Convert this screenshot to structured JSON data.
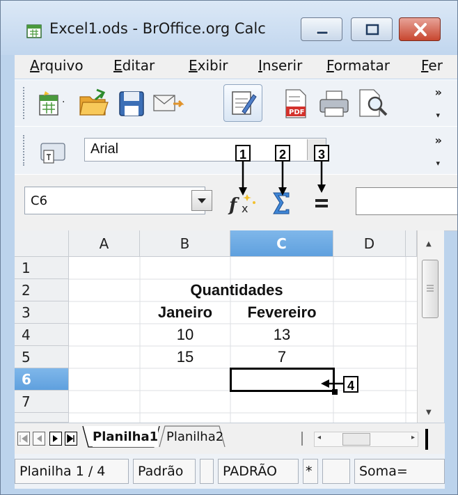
{
  "window": {
    "title": "Excel1.ods - BrOffice.org Calc"
  },
  "menu": [
    {
      "hot": "A",
      "rest": "rquivo"
    },
    {
      "hot": "E",
      "rest": "ditar"
    },
    {
      "hot": "E",
      "rest": "xibir"
    },
    {
      "hot": "I",
      "rest": "nserir"
    },
    {
      "hot": "F",
      "rest": "ormatar"
    },
    {
      "hot": "F",
      "rest": "er"
    }
  ],
  "formatting": {
    "font_name": "Arial"
  },
  "formula_bar": {
    "name_box": "C6",
    "formula_value": ""
  },
  "callouts": [
    "1",
    "2",
    "3",
    "4"
  ],
  "sheet": {
    "columns": [
      "A",
      "B",
      "C",
      "D"
    ],
    "rows": [
      "1",
      "2",
      "3",
      "4",
      "5",
      "6",
      "7"
    ],
    "selected_column": "C",
    "selected_row": "6",
    "cells": {
      "B2": "Quantidades",
      "B3": "Janeiro",
      "C3": "Fevereiro",
      "B4": "10",
      "C4": "13",
      "B5": "15",
      "C5": "7"
    }
  },
  "tabs": [
    "Planilha1",
    "Planilha2"
  ],
  "status": {
    "sheet_position": "Planilha 1 / 4",
    "page_style": "Padrão",
    "insert_mode": "PADRÃO",
    "modified": "*",
    "sum": "Soma="
  },
  "colors": {
    "selected_header": "#6aa9e3",
    "title_bar": "#c9dbef",
    "close_button": "#c8462f"
  }
}
